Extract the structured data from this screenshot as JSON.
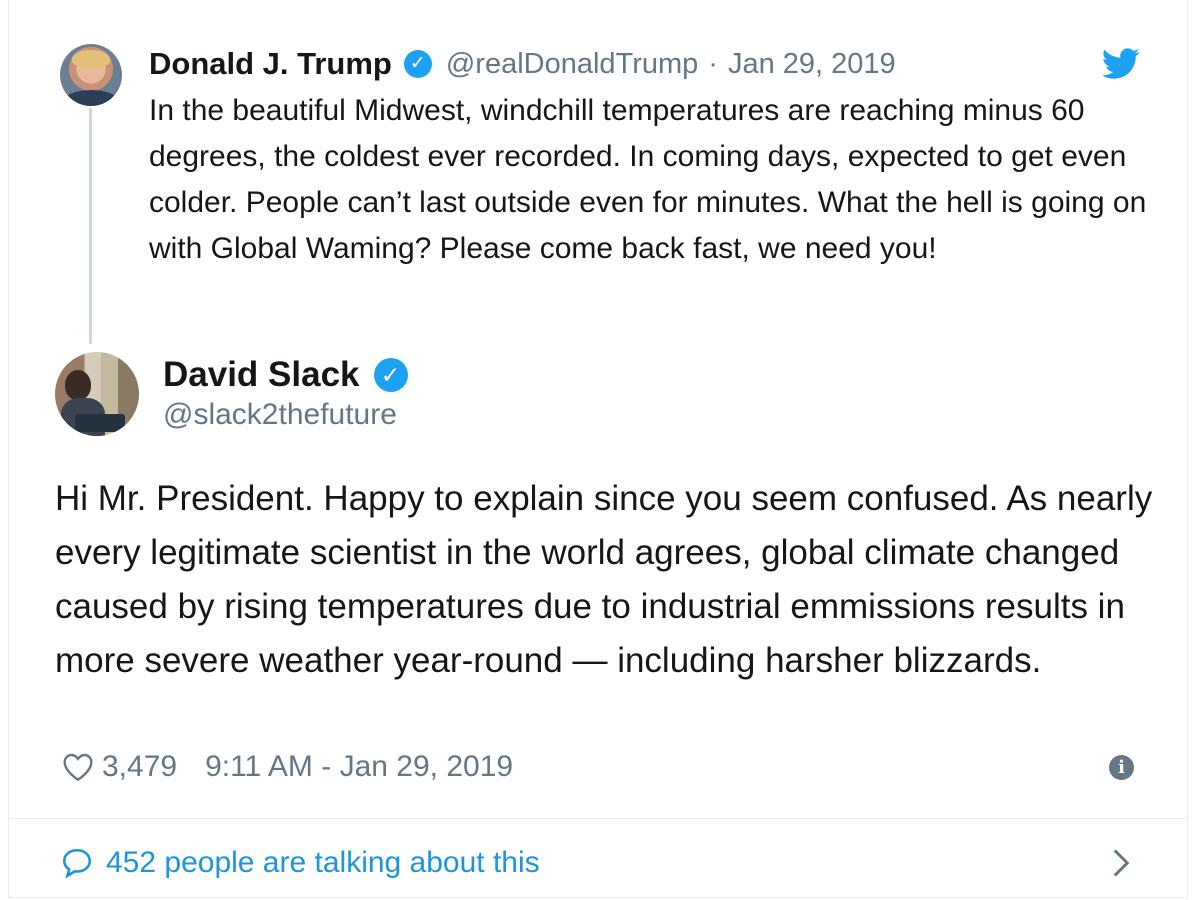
{
  "parent_tweet": {
    "name": "Donald J. Trump",
    "handle": "@realDonaldTrump",
    "separator": "·",
    "date": "Jan 29, 2019",
    "text": "In the beautiful Midwest, windchill temperatures are reaching minus 60 degrees, the coldest ever recorded. In coming days, expected to get even colder. People can’t last outside even for minutes. What the hell is going on with Global Waming? Please come back fast, we need you!"
  },
  "main_tweet": {
    "name": "David Slack",
    "handle": "@slack2thefuture",
    "text": "Hi Mr. President. Happy to explain since you seem confused. As nearly every legitimate scientist in the world agrees, global climate changed caused by rising temperatures due to industrial emmissions results in more severe weather year-round — including harsher blizzards.",
    "likes": "3,479",
    "timestamp": "9:11 AM - Jan 29, 2019"
  },
  "footer": {
    "talking_text": "452 people are talking about this"
  },
  "icons": {
    "verified": "verified-badge-icon",
    "bird": "twitter-bird-icon",
    "heart": "heart-icon",
    "info": "info-icon",
    "bubble": "speech-bubble-icon",
    "chevron": "chevron-right-icon"
  },
  "colors": {
    "accent": "#1da1f2",
    "link": "#1b95e0",
    "secondary_text": "#657786",
    "primary_text": "#14171a"
  }
}
